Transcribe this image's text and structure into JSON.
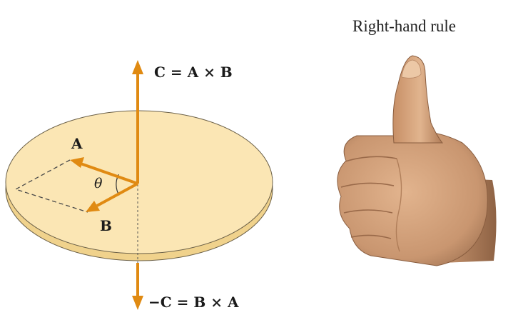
{
  "diagram": {
    "labels": {
      "c_eq": "C = A × B",
      "neg_c_eq": "−C = B × A",
      "vector_a": "A",
      "vector_b": "B",
      "angle": "θ",
      "title": "Right-hand rule"
    },
    "colors": {
      "disk_fill": "#fbe6b4",
      "disk_edge": "#f0d28c",
      "disk_stroke": "#6b6048",
      "arrow": "#e08a12",
      "dashed": "#4a4a4a",
      "text": "#1a1a1a"
    },
    "icons": {
      "hand": "thumbs-up-hand-icon"
    }
  }
}
